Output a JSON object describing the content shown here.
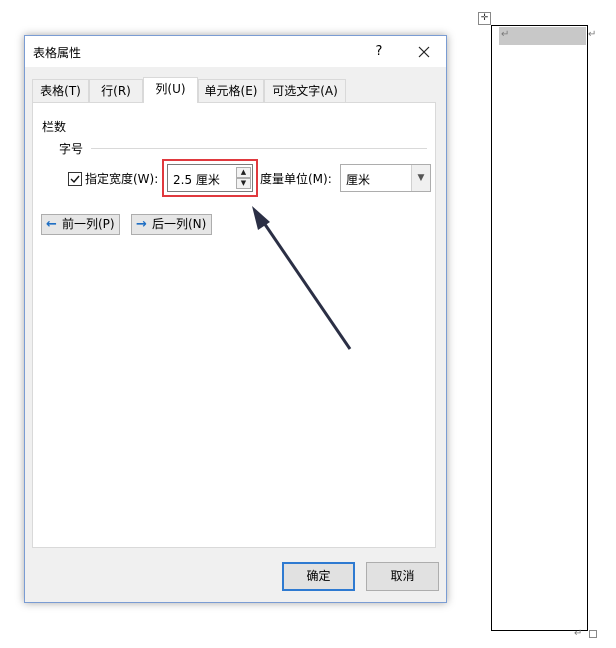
{
  "dialog": {
    "title": "表格属性",
    "help": "?",
    "tabs": [
      {
        "label": "表格(T)"
      },
      {
        "label": "行(R)"
      },
      {
        "label": "列(U)"
      },
      {
        "label": "单元格(E)"
      },
      {
        "label": "可选文字(A)"
      }
    ],
    "active_tab": "列(U)",
    "section_label": "栏数",
    "group_label": "字号",
    "width_checkbox_label": "指定宽度(W):",
    "width_checked": true,
    "width_value": "2.5 厘米",
    "unit_label": "度量单位(M):",
    "unit_value": "厘米",
    "prev_column": "前一列(P)",
    "next_column": "后一列(N)",
    "ok": "确定",
    "cancel": "取消"
  },
  "document": {
    "paragraph_mark": "↵",
    "move_handle": "✛"
  },
  "colors": {
    "highlight": "#e0393e",
    "arrow": "#2b2f45",
    "accent": "#2e7ad1"
  }
}
